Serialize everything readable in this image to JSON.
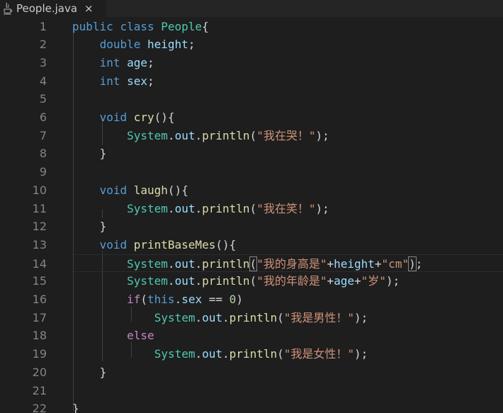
{
  "tab": {
    "icon": "java-file-icon",
    "label": "People.java",
    "close_glyph": "×"
  },
  "code_lines": [
    "public class People{",
    "    double height;",
    "    int age;",
    "    int sex;",
    "",
    "    void cry(){",
    "        System.out.println(\"我在哭！\");",
    "    }",
    "",
    "    void laugh(){",
    "        System.out.println(\"我在笑！\");",
    "    }",
    "    void printBaseMes(){",
    "        System.out.println(\"我的身高是\"+height+\"cm\");",
    "        System.out.println(\"我的年龄是\"+age+\"岁\");",
    "        if(this.sex == 0)",
    "            System.out.println(\"我是男性！\");",
    "        else",
    "            System.out.println(\"我是女性！\");",
    "    }",
    "",
    "}"
  ],
  "line_numbers": [
    "1",
    "2",
    "3",
    "4",
    "5",
    "6",
    "7",
    "8",
    "9",
    "10",
    "11",
    "12",
    "13",
    "14",
    "15",
    "16",
    "17",
    "18",
    "19",
    "20",
    "21",
    "22"
  ],
  "current_line": 14,
  "colors": {
    "keyword": "#569cd6",
    "control": "#c586c0",
    "class": "#4ec9b0",
    "variable": "#9cdcfe",
    "function": "#dcdcaa",
    "string": "#ce9178",
    "number": "#b5cea8",
    "background": "#1e1e1e",
    "line_number": "#858585"
  }
}
